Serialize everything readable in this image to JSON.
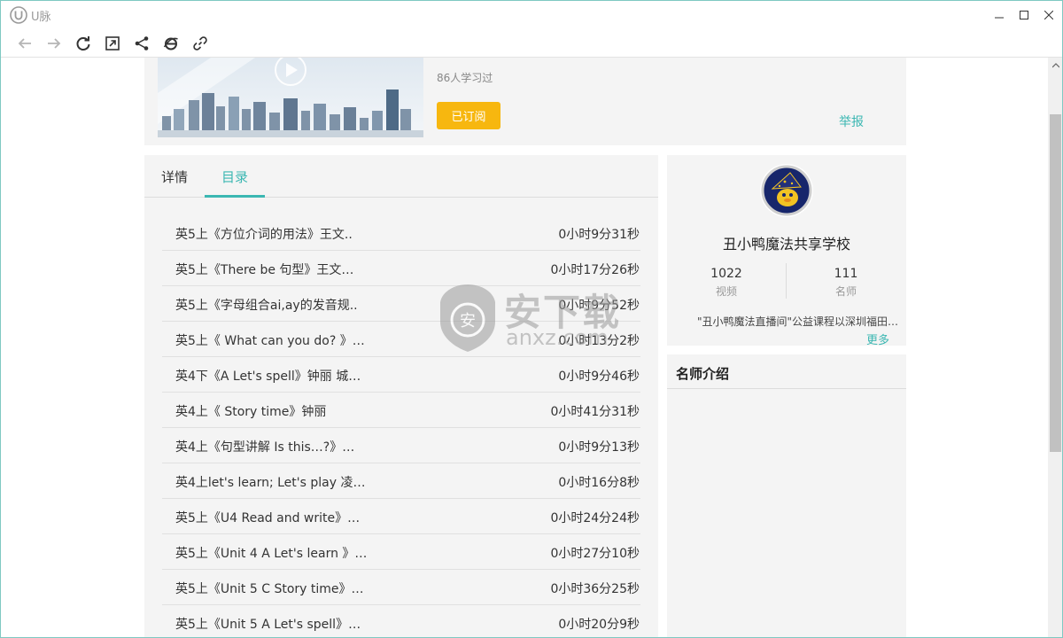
{
  "window": {
    "title": "U脉"
  },
  "toolbar": {
    "icons": [
      "back-icon",
      "forward-icon",
      "refresh-icon",
      "open-external-icon",
      "share-icon",
      "ie-browser-icon",
      "copy-link-icon"
    ]
  },
  "course": {
    "learned_text": "86人学习过",
    "subscribed_label": "已订阅",
    "report_label": "举报"
  },
  "tabs": [
    {
      "label": "详情",
      "active": false
    },
    {
      "label": "目录",
      "active": true
    }
  ],
  "catalog": [
    {
      "title": "英5上《方位介词的用法》王文..",
      "duration": "0小时9分31秒"
    },
    {
      "title": "英5上《There be 句型》王文…",
      "duration": "0小时17分26秒"
    },
    {
      "title": "英5上《字母组合ai,ay的发音规..",
      "duration": "0小时9分52秒"
    },
    {
      "title": "英5上《 What can you do? 》…",
      "duration": "0小时13分2秒"
    },
    {
      "title": "英4下《A Let's spell》钟丽 城…",
      "duration": "0小时9分46秒"
    },
    {
      "title": "英4上《 Story time》钟丽",
      "duration": "0小时41分31秒"
    },
    {
      "title": "英4上《句型讲解 Is this…?》…",
      "duration": "0小时9分13秒"
    },
    {
      "title": "英4上let's learn; Let's play 凌…",
      "duration": "0小时16分8秒"
    },
    {
      "title": "英5上《U4 Read and write》…",
      "duration": "0小时24分24秒"
    },
    {
      "title": "英5上《Unit 4 A Let's learn 》…",
      "duration": "0小时27分10秒"
    },
    {
      "title": "英5上《Unit 5 C Story time》…",
      "duration": "0小时36分25秒"
    },
    {
      "title": "英5上《Unit 5 A Let's spell》…",
      "duration": "0小时20分9秒"
    }
  ],
  "school": {
    "name": "丑小鸭魔法共享学校",
    "video_count": "1022",
    "video_label": "视频",
    "teacher_count": "111",
    "teacher_label": "名师",
    "description": "\"丑小鸭魔法直播间\"公益课程以深圳福田…",
    "more_label": "更多"
  },
  "teacher_section": {
    "title": "名师介绍"
  },
  "watermark": {
    "cn": "安下载",
    "en": "anxz.com"
  },
  "colors": {
    "accent": "#3bb7b2",
    "subscribe": "#f7b70f",
    "panel": "#f4f4f4"
  }
}
